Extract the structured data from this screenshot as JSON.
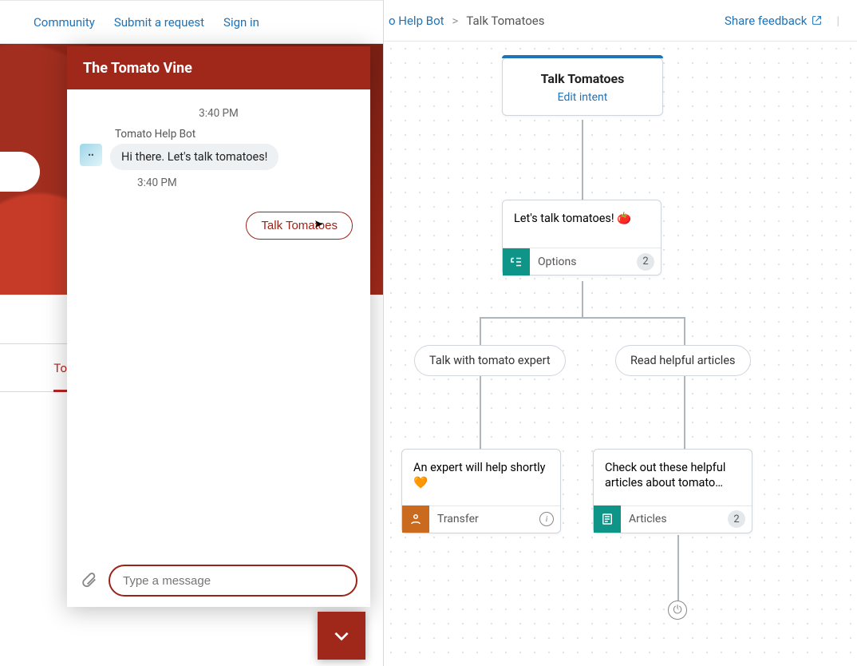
{
  "hc": {
    "nav": {
      "community": "Community",
      "submit": "Submit a request",
      "signin": "Sign in"
    },
    "tab_fragment": "To"
  },
  "widget": {
    "title": "The Tomato Vine",
    "timestamp_top": "3:40 PM",
    "bot_name": "Tomato Help Bot",
    "greeting": "Hi there. Let's talk tomatoes!",
    "timestamp_after": "3:40 PM",
    "quick_reply": "Talk Tomatoes",
    "input_placeholder": "Type a message"
  },
  "builder": {
    "breadcrumb": {
      "parent_fragment": "o Help Bot",
      "sep": ">",
      "current": "Talk Tomatoes"
    },
    "share": "Share feedback",
    "root": {
      "title": "Talk Tomatoes",
      "edit": "Edit intent"
    },
    "step": {
      "text": "Let's talk tomatoes! 🍅",
      "footer_label": "Options",
      "count": "2"
    },
    "option_left": "Talk with tomato expert",
    "option_right": "Read helpful articles",
    "leaf_left": {
      "text": "An expert will help shortly 🧡",
      "footer_label": "Transfer"
    },
    "leaf_right": {
      "text": "Check out these helpful articles about tomato…",
      "footer_label": "Articles",
      "count": "2"
    }
  }
}
